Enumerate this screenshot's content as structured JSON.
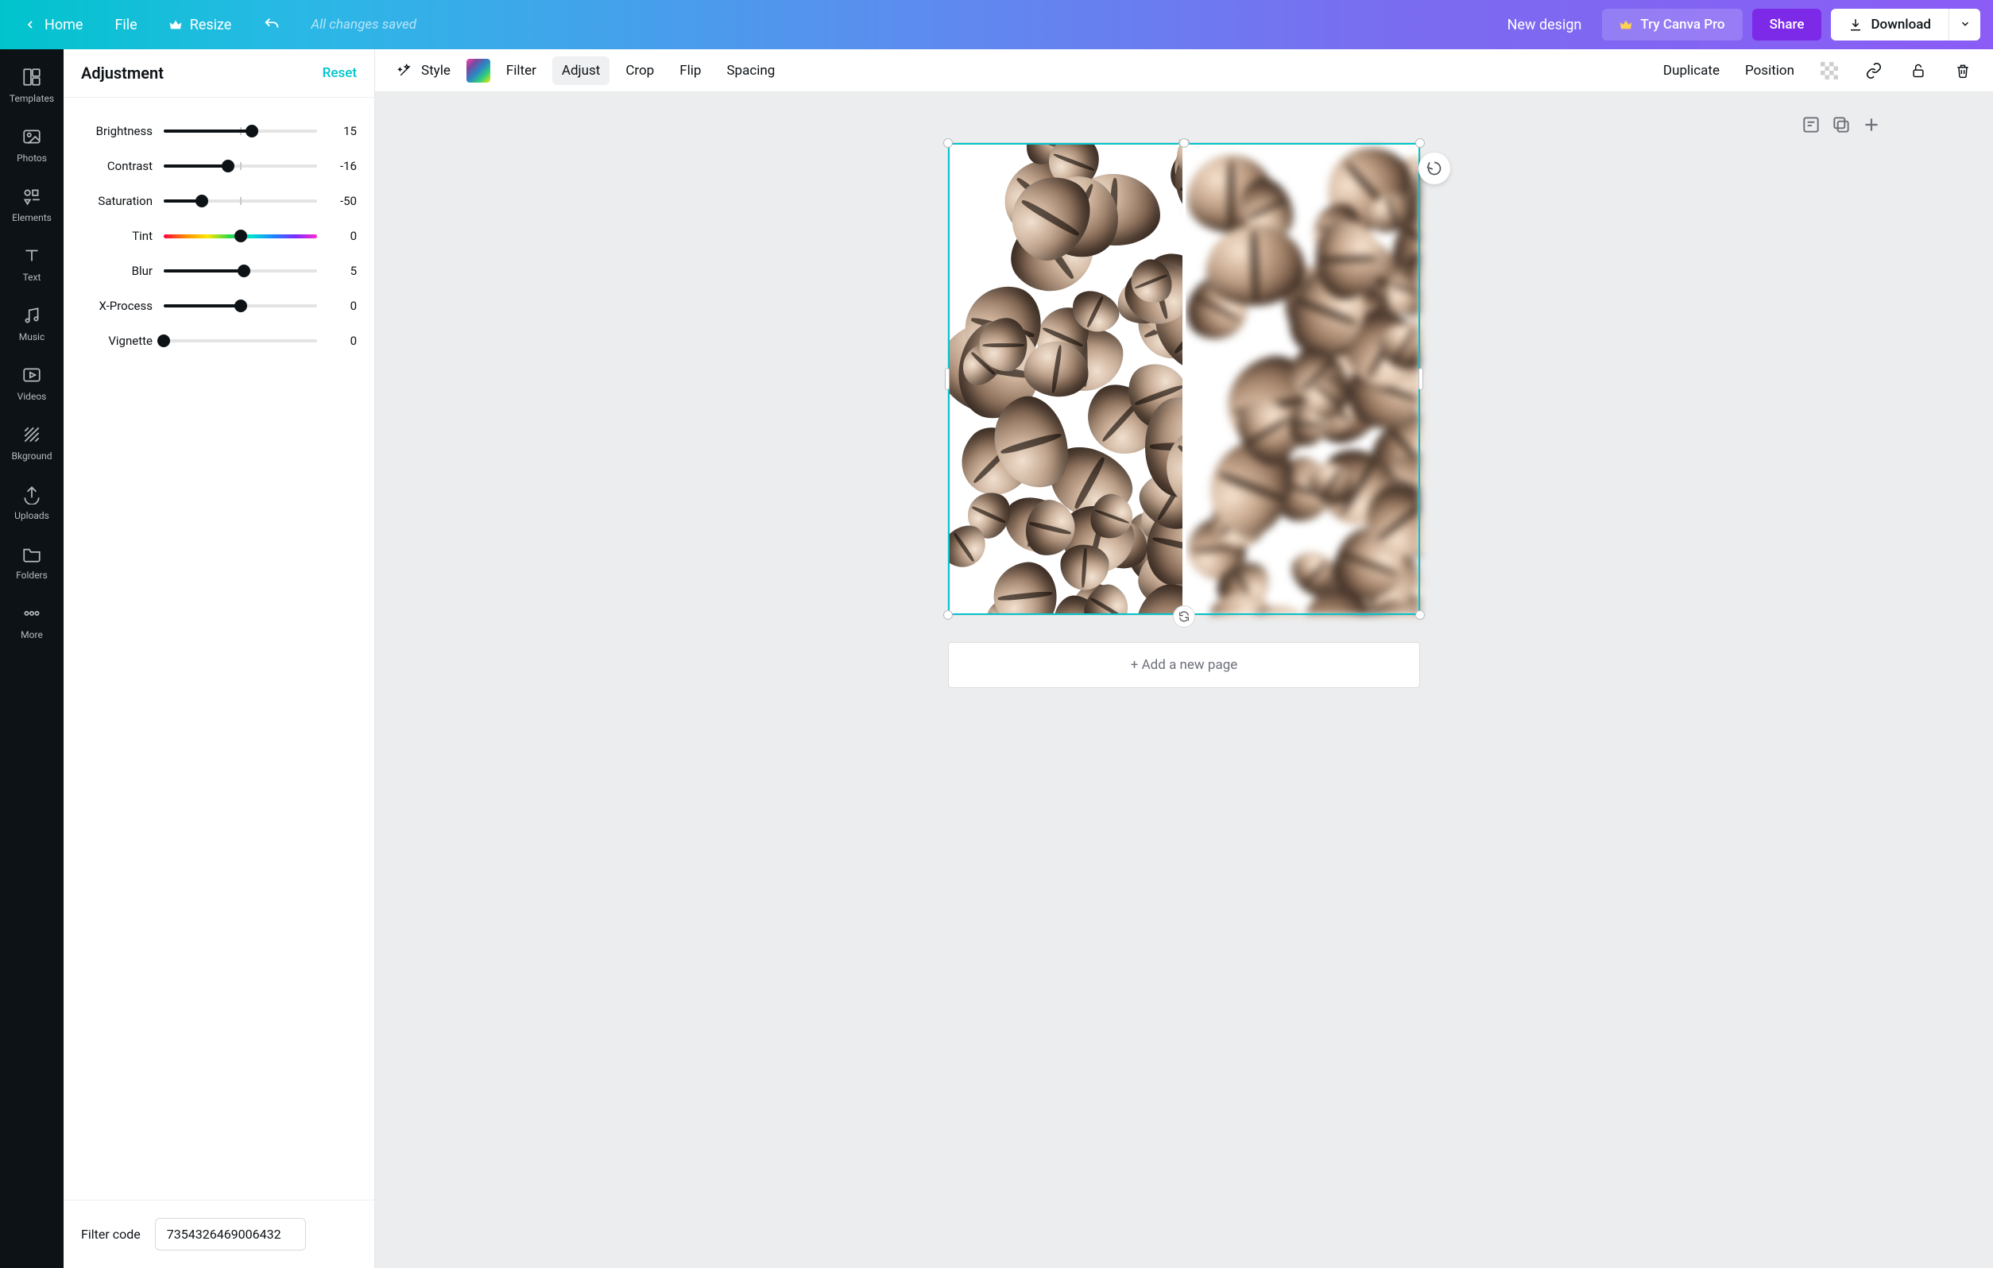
{
  "topbar": {
    "home": "Home",
    "file": "File",
    "resize": "Resize",
    "save_status": "All changes saved",
    "new_design": "New design",
    "try_pro": "Try Canva Pro",
    "share": "Share",
    "download": "Download"
  },
  "rail": [
    {
      "id": "templates",
      "label": "Templates"
    },
    {
      "id": "photos",
      "label": "Photos"
    },
    {
      "id": "elements",
      "label": "Elements"
    },
    {
      "id": "text",
      "label": "Text"
    },
    {
      "id": "music",
      "label": "Music"
    },
    {
      "id": "videos",
      "label": "Videos"
    },
    {
      "id": "bkground",
      "label": "Bkground"
    },
    {
      "id": "uploads",
      "label": "Uploads"
    },
    {
      "id": "folders",
      "label": "Folders"
    },
    {
      "id": "more",
      "label": "More"
    }
  ],
  "panel": {
    "title": "Adjustment",
    "reset": "Reset"
  },
  "sliders": [
    {
      "label": "Brightness",
      "value": 15,
      "min": -100,
      "max": 100,
      "bipolar": true
    },
    {
      "label": "Contrast",
      "value": -16,
      "min": -100,
      "max": 100,
      "bipolar": true
    },
    {
      "label": "Saturation",
      "value": -50,
      "min": -100,
      "max": 100,
      "bipolar": true
    },
    {
      "label": "Tint",
      "value": 0,
      "min": -100,
      "max": 100,
      "rainbow": true
    },
    {
      "label": "Blur",
      "value": 5,
      "min": -100,
      "max": 100,
      "bipolar": true
    },
    {
      "label": "X-Process",
      "value": 0,
      "min": -100,
      "max": 100,
      "bipolar": true
    },
    {
      "label": "Vignette",
      "value": 0,
      "min": 0,
      "max": 100,
      "bipolar": false
    }
  ],
  "filtercode": {
    "label": "Filter code",
    "value": "7354326469006432"
  },
  "ctx": {
    "style": "Style",
    "filter": "Filter",
    "adjust": "Adjust",
    "crop": "Crop",
    "flip": "Flip",
    "spacing": "Spacing",
    "duplicate": "Duplicate",
    "position": "Position"
  },
  "add_page": "+ Add a new page"
}
